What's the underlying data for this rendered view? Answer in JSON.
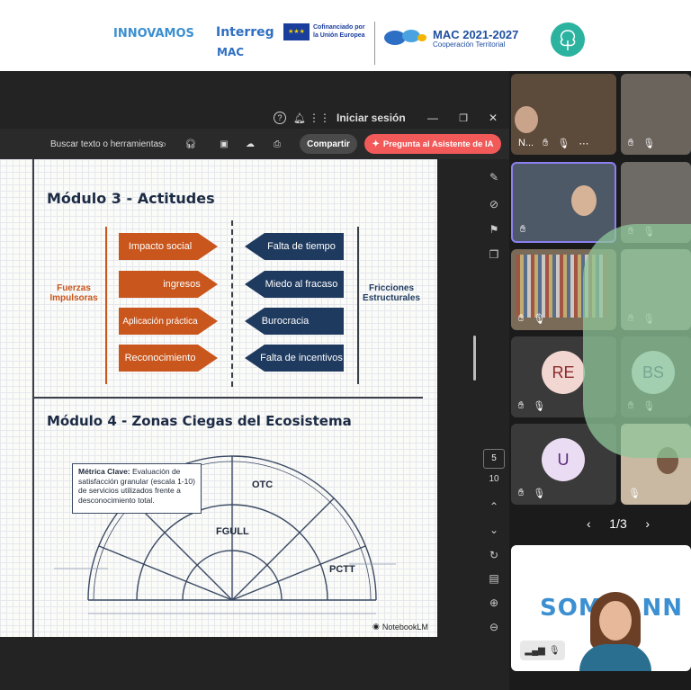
{
  "banner": {
    "innovamos": "INNOVAMOS",
    "interreg": "Interreg",
    "interreg_sub": "MAC",
    "cofinanciado": "Cofinanciado por\nla Unión Europea",
    "mac_title": "MAC 2021-2027",
    "mac_sub": "Cooperación Territorial"
  },
  "pdf": {
    "signin": "Iniciar sesión",
    "search_placeholder": "Buscar texto o herramientas",
    "share": "Compartir",
    "ai_button": "Pregunta al Asistente de IA",
    "page_current": "5",
    "page_total": "10"
  },
  "slide": {
    "m3_title": "Módulo 3 - Actitudes",
    "left_label": "Fuerzas\nImpulsoras",
    "right_label": "Fricciones\nEstructurales",
    "left_items": [
      "Impacto social",
      "ingresos",
      "Aplicación práctica",
      "Reconocimiento"
    ],
    "right_items": [
      "Falta de tiempo",
      "Miedo al fracaso",
      "Burocracia",
      "Falta de incentivos"
    ],
    "m4_title": "Módulo 4 - Zonas Ciegas del Ecosistema",
    "metric_bold": "Métrica Clave:",
    "metric_text": " Evaluación de satisfacción granular (escala 1-10) de servicios utilizados frente a desconocimiento total.",
    "otc": "OTC",
    "fgull": "FGULL",
    "pctt": "PCTT",
    "footer": "NotebookLM"
  },
  "gallery": {
    "tile_name": "N...",
    "avatars": [
      "RE",
      "BS",
      "U"
    ],
    "pager": "1/3"
  },
  "colors": {
    "orange": "#c9561c",
    "navy": "#1f3a5f",
    "ai_pink": "#ff5f5f",
    "teal": "#2bb3a0"
  }
}
